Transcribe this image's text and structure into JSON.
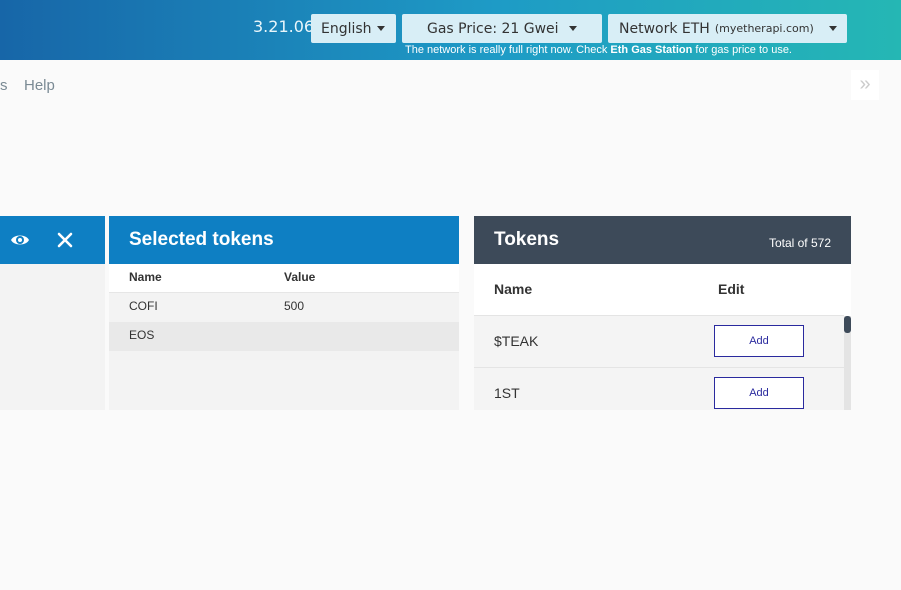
{
  "header": {
    "version": "3.21.06",
    "language": "English",
    "gas_price": "Gas Price: 21 Gwei",
    "network": "Network ETH",
    "network_node": "(myetherapi.com)",
    "notice_pre": "The network is really full right now. Check ",
    "notice_link": "Eth Gas Station",
    "notice_post": " for gas price to use."
  },
  "nav": {
    "cut_item": "s",
    "help": "Help",
    "more": "»"
  },
  "selected_tokens": {
    "title": "Selected tokens",
    "columns": {
      "name": "Name",
      "value": "Value"
    },
    "rows": [
      {
        "name": "COFI",
        "value": "500"
      },
      {
        "name": "EOS",
        "value": ""
      }
    ]
  },
  "tokens": {
    "title": "Tokens",
    "total": "Total of 572",
    "columns": {
      "name": "Name",
      "edit": "Edit"
    },
    "rows": [
      {
        "name": "$TEAK",
        "action": "Add"
      },
      {
        "name": "1ST",
        "action": "Add"
      }
    ]
  },
  "colors": {
    "header_gradient_start": "#1766a8",
    "header_gradient_end": "#25b7b4",
    "panel_blue": "#0e7fc3",
    "panel_dark": "#3d4a59",
    "add_button": "#2a2a9e"
  },
  "icons": [
    "eye-icon",
    "close-icon",
    "caret-down-icon",
    "double-chevron-right-icon"
  ]
}
